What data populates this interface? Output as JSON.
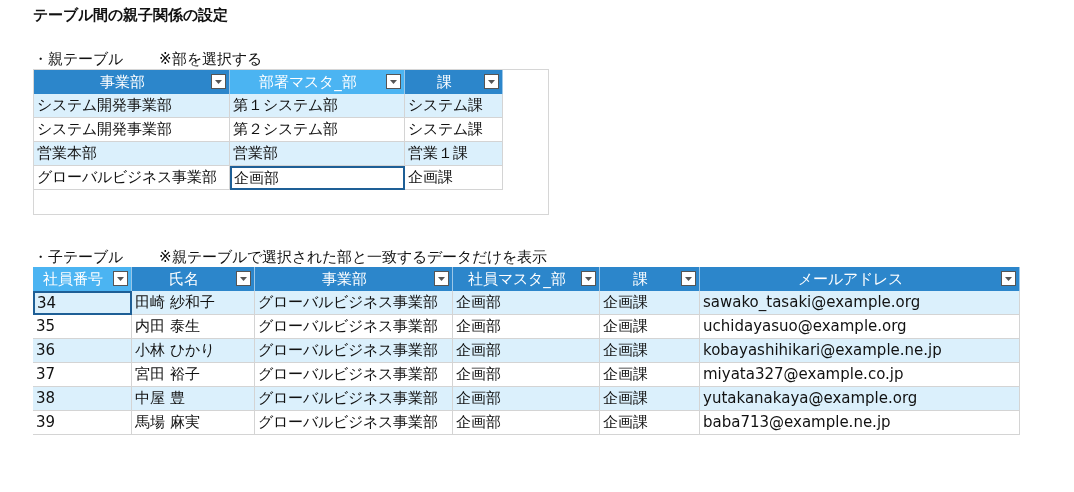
{
  "title": "テーブル間の親子関係の設定",
  "sections": [
    {
      "label": "・親テーブル",
      "note": "※部を選択する",
      "framed": true,
      "columns": [
        {
          "label": "事業部",
          "selected": false
        },
        {
          "label": "部署マスタ_部",
          "selected": true
        },
        {
          "label": "課",
          "selected": false
        }
      ],
      "rows": [
        {
          "cells": [
            {
              "text": "システム開発事業部",
              "selected": false
            },
            {
              "text": "第１システム部",
              "selected": false
            },
            {
              "text": "システム課",
              "selected": false
            }
          ]
        },
        {
          "cells": [
            {
              "text": "システム開発事業部",
              "selected": false
            },
            {
              "text": "第２システム部",
              "selected": false
            },
            {
              "text": "システム課",
              "selected": false
            }
          ]
        },
        {
          "cells": [
            {
              "text": "営業本部",
              "selected": false
            },
            {
              "text": "営業部",
              "selected": false
            },
            {
              "text": "営業１課",
              "selected": false
            }
          ]
        },
        {
          "cells": [
            {
              "text": "グローバルビジネス事業部",
              "selected": false
            },
            {
              "text": "企画部",
              "selected": true
            },
            {
              "text": "企画課",
              "selected": false
            }
          ]
        }
      ]
    },
    {
      "label": "・子テーブル",
      "note": "※親テーブルで選択された部と一致するデータだけを表示",
      "framed": false,
      "columns": [
        {
          "label": "社員番号",
          "selected": true
        },
        {
          "label": "氏名",
          "selected": false
        },
        {
          "label": "事業部",
          "selected": false
        },
        {
          "label": "社員マスタ_部",
          "selected": false
        },
        {
          "label": "課",
          "selected": false
        },
        {
          "label": "メールアドレス",
          "selected": false
        }
      ],
      "rows": [
        {
          "cells": [
            {
              "text": "34",
              "selected": true
            },
            {
              "text": "田崎 紗和子",
              "selected": false
            },
            {
              "text": "グローバルビジネス事業部",
              "selected": false
            },
            {
              "text": "企画部",
              "selected": false
            },
            {
              "text": "企画課",
              "selected": false
            },
            {
              "text": "sawako_tasaki@example.org",
              "selected": false
            }
          ]
        },
        {
          "cells": [
            {
              "text": "35",
              "selected": false
            },
            {
              "text": "内田 泰生",
              "selected": false
            },
            {
              "text": "グローバルビジネス事業部",
              "selected": false
            },
            {
              "text": "企画部",
              "selected": false
            },
            {
              "text": "企画課",
              "selected": false
            },
            {
              "text": "uchidayasuo@example.org",
              "selected": false
            }
          ]
        },
        {
          "cells": [
            {
              "text": "36",
              "selected": false
            },
            {
              "text": "小林 ひかり",
              "selected": false
            },
            {
              "text": "グローバルビジネス事業部",
              "selected": false
            },
            {
              "text": "企画部",
              "selected": false
            },
            {
              "text": "企画課",
              "selected": false
            },
            {
              "text": "kobayashihikari@example.ne.jp",
              "selected": false
            }
          ]
        },
        {
          "cells": [
            {
              "text": "37",
              "selected": false
            },
            {
              "text": "宮田 裕子",
              "selected": false
            },
            {
              "text": "グローバルビジネス事業部",
              "selected": false
            },
            {
              "text": "企画部",
              "selected": false
            },
            {
              "text": "企画課",
              "selected": false
            },
            {
              "text": "miyata327@example.co.jp",
              "selected": false
            }
          ]
        },
        {
          "cells": [
            {
              "text": "38",
              "selected": false
            },
            {
              "text": "中屋 豊",
              "selected": false
            },
            {
              "text": "グローバルビジネス事業部",
              "selected": false
            },
            {
              "text": "企画部",
              "selected": false
            },
            {
              "text": "企画課",
              "selected": false
            },
            {
              "text": "yutakanakaya@example.org",
              "selected": false
            }
          ]
        },
        {
          "cells": [
            {
              "text": "39",
              "selected": false
            },
            {
              "text": "馬場 麻実",
              "selected": false
            },
            {
              "text": "グローバルビジネス事業部",
              "selected": false
            },
            {
              "text": "企画部",
              "selected": false
            },
            {
              "text": "企画課",
              "selected": false
            },
            {
              "text": "baba713@example.ne.jp",
              "selected": false
            }
          ]
        }
      ]
    }
  ]
}
